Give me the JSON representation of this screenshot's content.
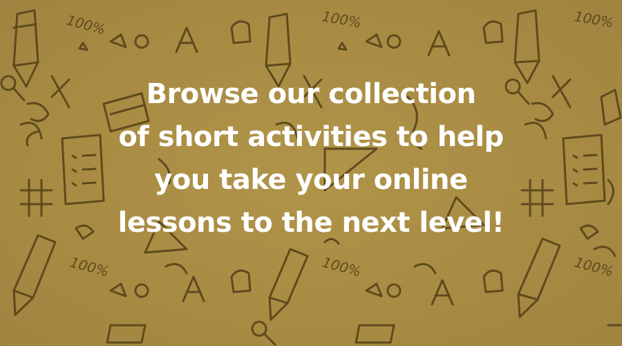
{
  "banner": {
    "background_color": "#a98c44",
    "doodle_color": "#5e4a1c",
    "text_color": "#ffffff",
    "message_lines": [
      "Browse our collection",
      "of short activities to help",
      "you take your online",
      "lessons to the next level!"
    ],
    "doodle_label": "100%",
    "doodle_icons": [
      "pencil-icon",
      "percent-icon",
      "checklist-icon",
      "tic-tac-toe-icon",
      "magnifier-icon",
      "triangle-ruler-icon",
      "letter-a-icon"
    ]
  }
}
